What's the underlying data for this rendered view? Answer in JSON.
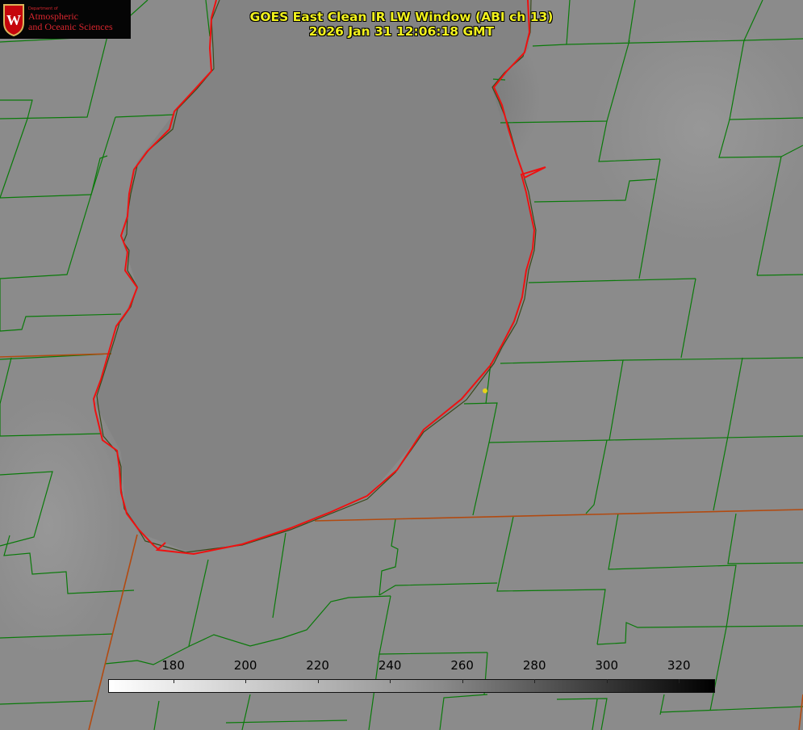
{
  "header": {
    "title_line1": "GOES East Clean IR LW Window (ABI ch 13)",
    "title_line2": "2026 Jan 31 12:06:18 GMT"
  },
  "logo": {
    "dept": "Department of",
    "line1": "Atmospheric",
    "line2": "and Oceanic Sciences",
    "crest_letter": "W"
  },
  "colorbar": {
    "min": 162,
    "max": 330,
    "ticks": [
      "180",
      "200",
      "220",
      "240",
      "260",
      "280",
      "300",
      "320"
    ]
  },
  "colors": {
    "county_lines": "#0a7a0a",
    "state_border": "#b24a10",
    "shoreline": "#ee1111",
    "marker": "#e6d21a",
    "title": "#f2f21d"
  }
}
